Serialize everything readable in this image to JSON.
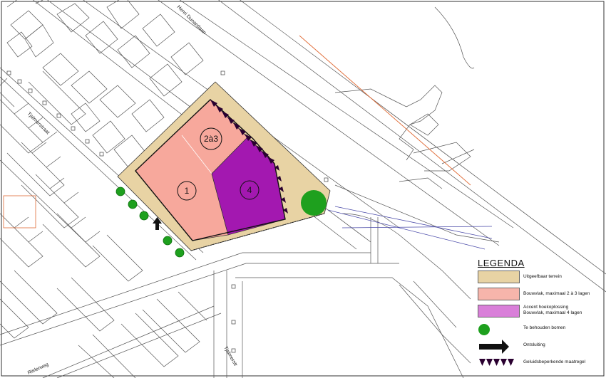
{
  "map": {
    "street_labels": {
      "henri_dunantlaan": "Henri Dunantlaan",
      "tjalmerstraat": "Tjalmerstraat",
      "rielerweg": "Rielerweg",
      "tjalmerstr": "Tjalmerstr"
    },
    "zones": {
      "zone_1": "1",
      "zone_2": "2à3",
      "zone_4": "4"
    },
    "colors": {
      "terrain": "#e8d3a4",
      "bouwvlak": "#f7a89c",
      "accent": "#a318b0",
      "tree": "#1ea01e",
      "railway": "#e06a35",
      "route": "#4a4aa8"
    }
  },
  "legend": {
    "title": "LEGENDA",
    "items": [
      {
        "label": "Uitgeefbaar terrein",
        "color": "#e8d3a4",
        "icon": "terrain-swatch"
      },
      {
        "label": "Bouwvlak, maximaal 2 à 3 lagen",
        "color": "#f7b5ab",
        "icon": "bouwvlak-swatch"
      },
      {
        "label_line1": "Accent hoekoplossing",
        "label_line2": "Bouwvlak, maximaal 4 lagen",
        "color": "#d97fd9",
        "icon": "accent-swatch"
      },
      {
        "label": "Te behouden bomen",
        "color": "#1ea01e",
        "icon": "tree-icon"
      },
      {
        "label": "Ontsluiting",
        "color": "#111111",
        "icon": "arrow-icon"
      },
      {
        "label": "Geluidsbeperkende maatregel",
        "color": "#2a0030",
        "icon": "noise-barrier-icon"
      }
    ]
  }
}
